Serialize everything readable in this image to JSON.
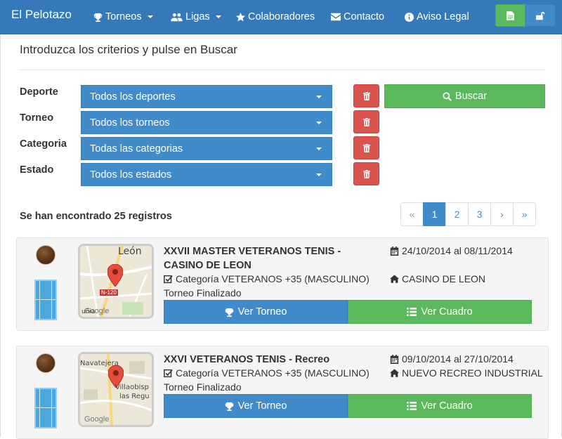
{
  "navbar": {
    "brand": "El Pelotazo",
    "items": [
      {
        "label": "Torneos",
        "icon": "trophy-icon"
      },
      {
        "label": "Ligas",
        "icon": "users-icon"
      },
      {
        "label": "Colaboradores",
        "icon": "star-icon"
      },
      {
        "label": "Contacto",
        "icon": "envelope-icon"
      },
      {
        "label": "Aviso Legal",
        "icon": "info-icon"
      }
    ],
    "buttons": [
      {
        "icon": "document-icon",
        "color": "#5cb85c"
      },
      {
        "icon": "unlock-icon",
        "color": "#428bca"
      }
    ]
  },
  "search": {
    "intro": "Introduzca los criterios y pulse en Buscar",
    "filters": [
      {
        "label": "Deporte",
        "value": "Todos los deportes"
      },
      {
        "label": "Torneo",
        "value": "Todos los torneos"
      },
      {
        "label": "Categoria",
        "value": "Todas las categorias"
      },
      {
        "label": "Estado",
        "value": "Todos los estados"
      }
    ],
    "search_label": "Buscar"
  },
  "results": {
    "summary": "Se han encontrado 25 registros",
    "pagination": [
      "«",
      "1",
      "2",
      "3",
      "›",
      "»"
    ],
    "current_page": "1"
  },
  "tournaments": [
    {
      "title": "XXVII MASTER VETERANOS TENIS - CASINO DE LEON",
      "dates": "24/10/2014 al 08/11/2014",
      "category": "Categoría VETERANOS +35 (MASCULINO)",
      "venue": "CASINO DE LEON",
      "status": "Torneo Finalizado",
      "map_labels": [
        "León",
        "N-120",
        "Google",
        "uñia"
      ],
      "btn_torneo": "Ver Torneo",
      "btn_cuadro": "Ver Cuadro"
    },
    {
      "title": "XXVI VETERANOS TENIS - Recreo",
      "dates": "09/10/2014 al 27/10/2014",
      "category": "Categoría VETERANOS +35 (MASCULINO)",
      "venue": "NUEVO RECREO INDUSTRIAL",
      "status": "Torneo Finalizado",
      "map_labels": [
        "Navatejera",
        "Villaobisp",
        "las Regu",
        "Google"
      ],
      "btn_torneo": "Ver Torneo",
      "btn_cuadro": "Ver Cuadro"
    }
  ],
  "colors": {
    "primary": "#428bca",
    "success": "#5cb85c",
    "danger": "#d9534f",
    "navbar": "#3579b8"
  }
}
